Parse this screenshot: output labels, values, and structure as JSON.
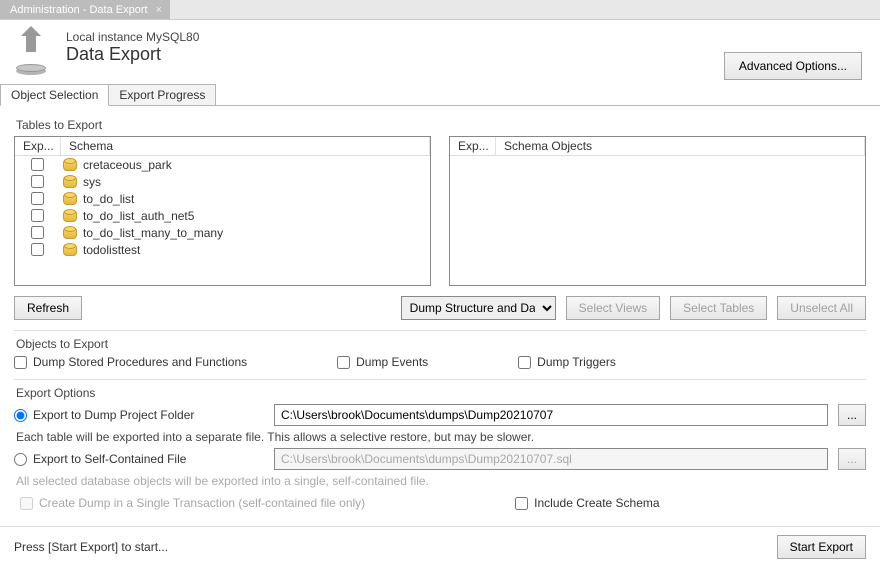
{
  "app_tab": {
    "title": "Administration - Data Export"
  },
  "header": {
    "instance": "Local instance MySQL80",
    "title": "Data Export",
    "advanced_button": "Advanced Options..."
  },
  "inner_tabs": {
    "object_selection": "Object Selection",
    "export_progress": "Export Progress"
  },
  "tables_to_export": {
    "label": "Tables to Export",
    "col_exp": "Exp...",
    "col_schema": "Schema",
    "items": [
      "cretaceous_park",
      "sys",
      "to_do_list",
      "to_do_list_auth_net5",
      "to_do_list_many_to_many",
      "todolisttest"
    ],
    "right_col_exp": "Exp...",
    "right_col_objects": "Schema Objects",
    "refresh": "Refresh",
    "dump_select": "Dump Structure and Dat",
    "select_views": "Select Views",
    "select_tables": "Select Tables",
    "unselect_all": "Unselect All"
  },
  "objects_to_export": {
    "label": "Objects to Export",
    "procedures": "Dump Stored Procedures and Functions",
    "events": "Dump Events",
    "triggers": "Dump Triggers"
  },
  "export_options": {
    "label": "Export Options",
    "folder_radio": "Export to Dump Project Folder",
    "folder_path": "C:\\Users\\brook\\Documents\\dumps\\Dump20210707",
    "folder_hint": "Each table will be exported into a separate file. This allows a selective restore, but may be slower.",
    "file_radio": "Export to Self-Contained File",
    "file_path": "C:\\Users\\brook\\Documents\\dumps\\Dump20210707.sql",
    "file_hint": "All selected database objects will be exported into a single, self-contained file.",
    "single_tx": "Create Dump in a Single Transaction (self-contained file only)",
    "include_schema": "Include Create Schema",
    "browse": "..."
  },
  "footer": {
    "hint": "Press [Start Export] to start...",
    "start": "Start Export"
  }
}
